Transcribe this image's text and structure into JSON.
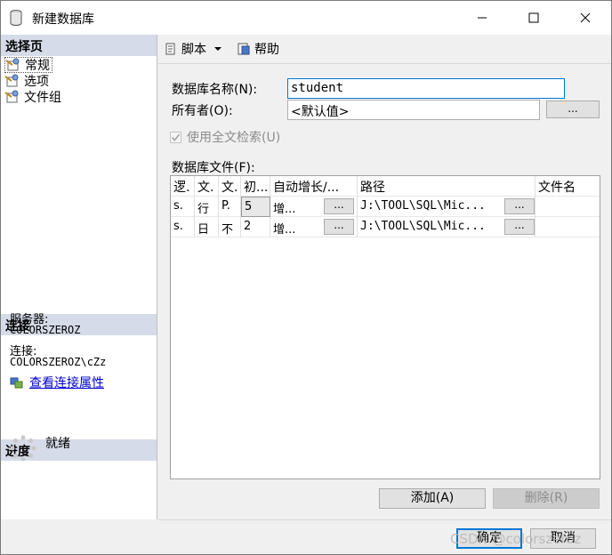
{
  "window": {
    "title": "新建数据库"
  },
  "sidebar": {
    "select_page_header": "选择页",
    "items": [
      {
        "label": "常规"
      },
      {
        "label": "选项"
      },
      {
        "label": "文件组"
      }
    ],
    "connection_header": "连接",
    "server_label": "服务器:",
    "server_value": "COLORSZEROZ",
    "connection_label": "连接:",
    "connection_value": "COLORSZEROZ\\cZz",
    "view_connection_link": "查看连接属性",
    "progress_header": "进度",
    "status": "就绪"
  },
  "toolbar": {
    "script_label": "脚本",
    "help_label": "帮助"
  },
  "form": {
    "db_name_label": "数据库名称(N):",
    "db_name_value": "student",
    "owner_label": "所有者(O):",
    "owner_value": "<默认值>",
    "browse_label": "...",
    "fulltext_label": "使用全文检索(U)",
    "fulltext_checked": true,
    "files_label": "数据库文件(F):"
  },
  "grid": {
    "headers": [
      "逻.",
      "文.",
      "文.",
      "初...",
      "自动增长/...",
      "路径",
      "文件名"
    ],
    "rows": [
      {
        "logical": "s.",
        "type": "行",
        "filegroup": "P.",
        "initial": "5",
        "autogrowth": "增...",
        "autogrowth_btn": "...",
        "path": "J:\\TOOL\\SQL\\Mic...",
        "path_btn": "...",
        "filename": ""
      },
      {
        "logical": "s.",
        "type": "日",
        "filegroup": "不",
        "initial": "2",
        "autogrowth": "增...",
        "autogrowth_btn": "...",
        "path": "J:\\TOOL\\SQL\\Mic...",
        "path_btn": "...",
        "filename": ""
      }
    ]
  },
  "buttons": {
    "add": "添加(A)",
    "remove": "删除(R)",
    "ok": "确定",
    "cancel": "取消"
  },
  "watermark": "CSDN @colorszeroz",
  "colors": {
    "section_header_bg": "#d6dbe9",
    "link": "#0000d0",
    "focus": "#0078d7"
  }
}
